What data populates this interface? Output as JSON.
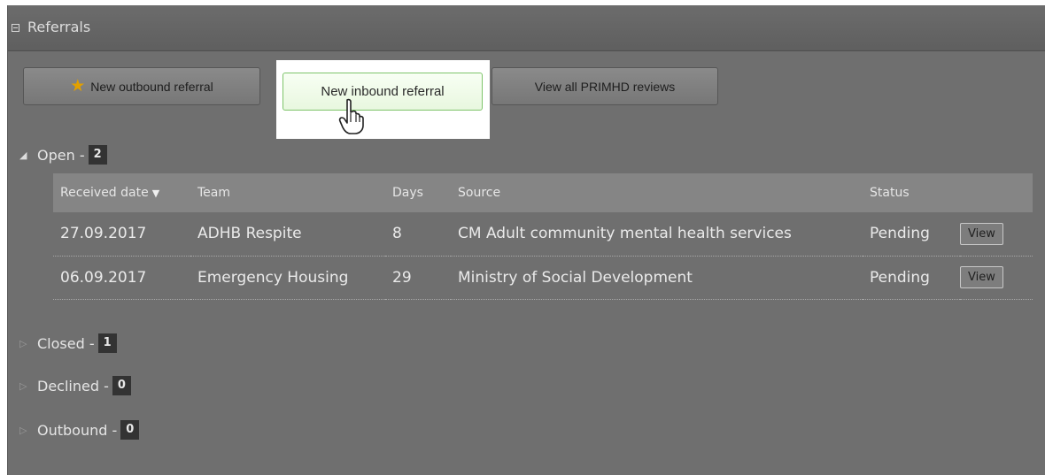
{
  "panel": {
    "title": "Referrals",
    "collapse_icon": "minus-box-icon"
  },
  "actions": {
    "new_outbound": {
      "label": "New outbound referral",
      "icon": "star-icon"
    },
    "new_inbound": {
      "label": "New inbound referral"
    },
    "view_reviews": {
      "label": "View all PRIMHD reviews"
    }
  },
  "sections": {
    "open": {
      "label": "Open -",
      "count": "2",
      "expanded": true
    },
    "closed": {
      "label": "Closed -",
      "count": "1",
      "expanded": false
    },
    "declined": {
      "label": "Declined -",
      "count": "0",
      "expanded": false
    },
    "outbound": {
      "label": "Outbound -",
      "count": "0",
      "expanded": false
    }
  },
  "table": {
    "headers": [
      "Received date",
      "Team",
      "Days",
      "Source",
      "Status"
    ],
    "sort_column": "Received date",
    "rows": [
      {
        "date": "27.09.2017",
        "team": "ADHB Respite",
        "days": "8",
        "source": "CM Adult community mental health services",
        "status": "Pending",
        "action": "View"
      },
      {
        "date": "06.09.2017",
        "team": "Emergency Housing",
        "days": "29",
        "source": "Ministry of Social Development",
        "status": "Pending",
        "action": "View"
      }
    ]
  },
  "colors": {
    "panel_bg": "#6f6f6f",
    "header_bg": "#5f5f5f",
    "star": "#e2a000",
    "inbound_border": "#7ec46a",
    "badge_bg": "#333333"
  }
}
